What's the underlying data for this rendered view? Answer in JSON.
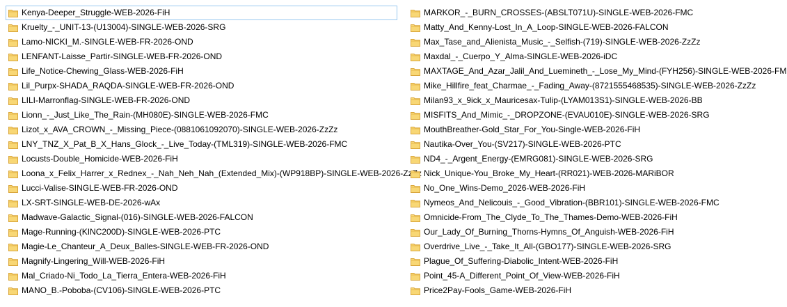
{
  "left_column": [
    "Kenya-Deeper_Struggle-WEB-2026-FiH",
    "Kruelty_-_UNIT-13-(U13004)-SINGLE-WEB-2026-SRG",
    "Lamo-NICKI_M.-SINGLE-WEB-FR-2026-OND",
    "LENFANT-Laisse_Partir-SINGLE-WEB-FR-2026-OND",
    "Life_Notice-Chewing_Glass-WEB-2026-FiH",
    "Lil_Purpx-SHADA_RAQDA-SINGLE-WEB-FR-2026-OND",
    "LILI-Marronflag-SINGLE-WEB-FR-2026-OND",
    "Lionn_-_Just_Like_The_Rain-(MH080E)-SINGLE-WEB-2026-FMC",
    "Lizot_x_AVA_CROWN_-_Missing_Piece-(0881061092070)-SINGLE-WEB-2026-ZzZz",
    "LNY_TNZ_X_Pat_B_X_Hans_Glock_-_Live_Today-(TML319)-SINGLE-WEB-2026-FMC",
    "Locusts-Double_Homicide-WEB-2026-FiH",
    "Loona_x_Felix_Harrer_x_Rednex_-_Nah_Neh_Nah_(Extended_Mix)-(WP918BP)-SINGLE-WEB-2026-ZzZz",
    "Lucci-Valise-SINGLE-WEB-FR-2026-OND",
    "LX-SRT-SINGLE-WEB-DE-2026-wAx",
    "Madwave-Galactic_Signal-(016)-SINGLE-WEB-2026-FALCON",
    "Mage-Running-(KINC200D)-SINGLE-WEB-2026-PTC",
    "Magie-Le_Chanteur_A_Deux_Balles-SINGLE-WEB-FR-2026-OND",
    "Magnify-Lingering_Will-WEB-2026-FiH",
    "Mal_Criado-Ni_Todo_La_Tierra_Entera-WEB-2026-FiH",
    "MANO_B.-Poboba-(CV106)-SINGLE-WEB-2026-PTC"
  ],
  "right_column": [
    "MARKOR_-_BURN_CROSSES-(ABSLT071U)-SINGLE-WEB-2026-FMC",
    "Matty_And_Kenny-Lost_In_A_Loop-SINGLE-WEB-2026-FALCON",
    "Max_Tase_and_Alienista_Music_-_Selfish-(719)-SINGLE-WEB-2026-ZzZz",
    "Maxdal_-_Cuerpo_Y_Alma-SINGLE-WEB-2026-iDC",
    "MAXTAGE_And_Azar_Jalil_And_Luemineth_-_Lose_My_Mind-(FYH256)-SINGLE-WEB-2026-FMC",
    "Mike_Hillfire_feat_Charmae_-_Fading_Away-(8721555468535)-SINGLE-WEB-2026-ZzZz",
    "Milan93_x_9ick_x_Mauricesax-Tulip-(LYAM013S1)-SINGLE-WEB-2026-BB",
    "MISFITS_And_Mimic_-_DROPZONE-(EVAU010E)-SINGLE-WEB-2026-SRG",
    "MouthBreather-Gold_Star_For_You-Single-WEB-2026-FiH",
    "Nautika-Over_You-(SV217)-SINGLE-WEB-2026-PTC",
    "ND4_-_Argent_Energy-(EMRG081)-SINGLE-WEB-2026-SRG",
    "Nick_Unique-You_Broke_My_Heart-(RR021)-WEB-2026-MARiBOR",
    "No_One_Wins-Demo_2026-WEB-2026-FiH",
    "Nymeos_And_Nelicouis_-_Good_Vibration-(BBR101)-SINGLE-WEB-2026-FMC",
    "Omnicide-From_The_Clyde_To_The_Thames-Demo-WEB-2026-FiH",
    "Our_Lady_Of_Burning_Thorns-Hymns_Of_Anguish-WEB-2026-FiH",
    "Overdrive_Live_-_Take_It_All-(GBO177)-SINGLE-WEB-2026-SRG",
    "Plague_Of_Suffering-Diabolic_Intent-WEB-2026-FiH",
    "Point_45-A_Different_Point_Of_View-WEB-2026-FiH",
    "Price2Pay-Fools_Game-WEB-2026-FiH"
  ],
  "icon": "folder-icon",
  "colors": {
    "folder_fill": "#f8d775",
    "folder_tab": "#e8b84a",
    "folder_edge": "#d9a53a",
    "focus_border": "#99c9ef"
  }
}
